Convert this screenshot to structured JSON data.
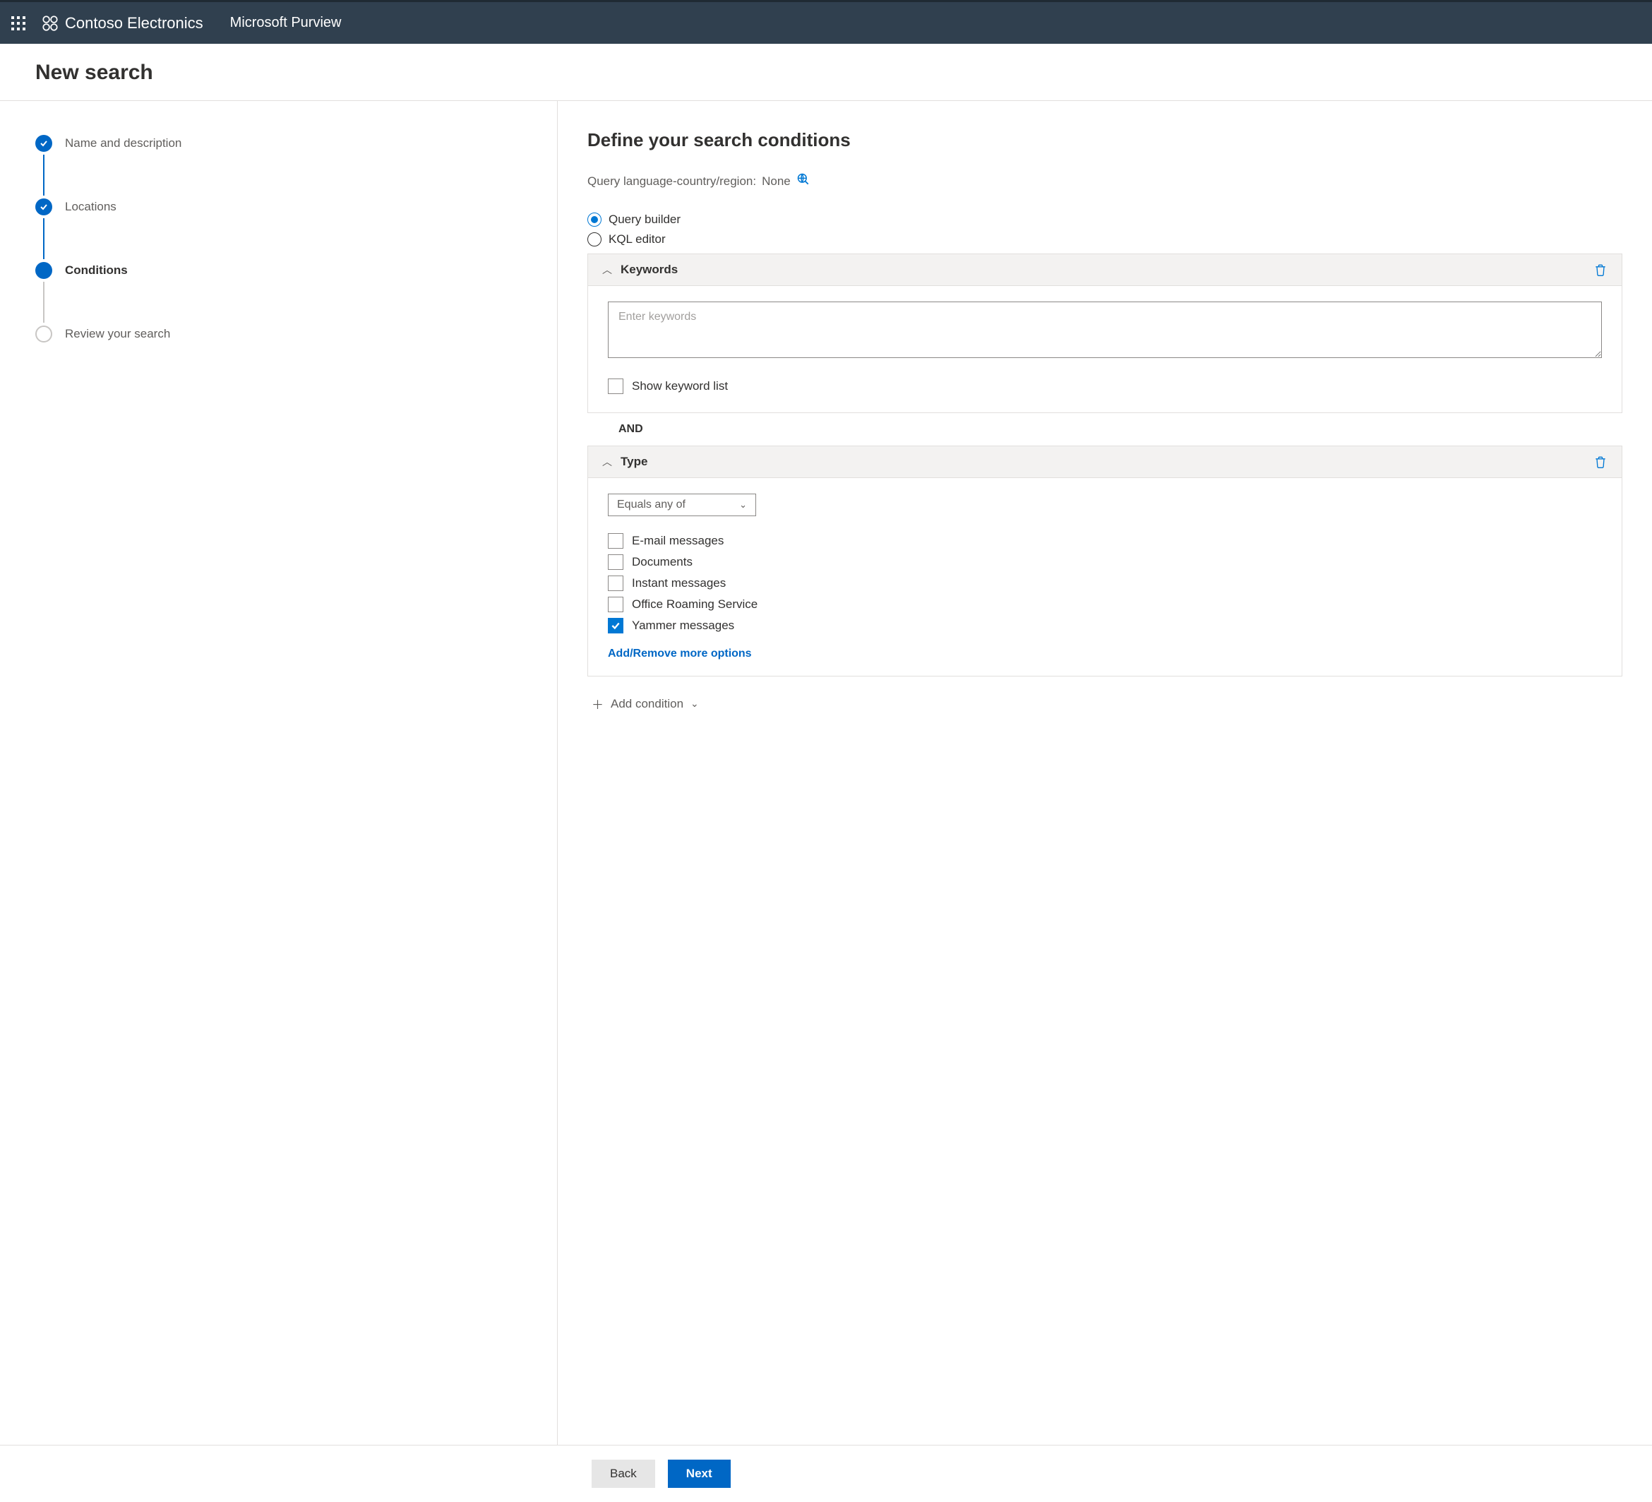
{
  "topbar": {
    "brand": "Contoso Electronics",
    "product": "Microsoft Purview"
  },
  "page_title": "New search",
  "steps": [
    {
      "label": "Name and description",
      "state": "done"
    },
    {
      "label": "Locations",
      "state": "done"
    },
    {
      "label": "Conditions",
      "state": "current"
    },
    {
      "label": "Review your search",
      "state": "upcoming"
    }
  ],
  "content": {
    "heading": "Define your search conditions",
    "query_lang_label": "Query language-country/region:",
    "query_lang_value": "None",
    "mode_options": [
      {
        "label": "Query builder",
        "selected": true
      },
      {
        "label": "KQL editor",
        "selected": false
      }
    ],
    "keywords_card": {
      "title": "Keywords",
      "placeholder": "Enter keywords",
      "show_list_label": "Show keyword list",
      "show_list_checked": false
    },
    "and_label": "AND",
    "type_card": {
      "title": "Type",
      "operator": "Equals any of",
      "options": [
        {
          "label": "E-mail messages",
          "checked": false
        },
        {
          "label": "Documents",
          "checked": false
        },
        {
          "label": "Instant messages",
          "checked": false
        },
        {
          "label": "Office Roaming Service",
          "checked": false
        },
        {
          "label": "Yammer messages",
          "checked": true
        }
      ],
      "more_link": "Add/Remove more options"
    },
    "add_condition_label": "Add condition"
  },
  "footer": {
    "back": "Back",
    "next": "Next"
  }
}
